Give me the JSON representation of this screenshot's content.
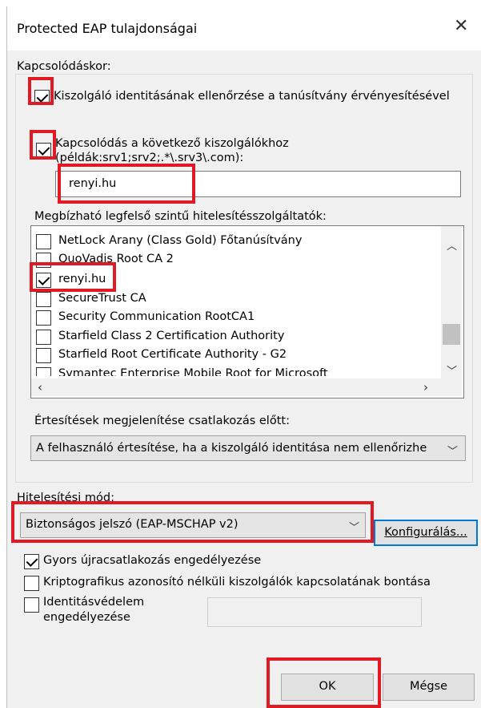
{
  "window": {
    "title": "Protected EAP tulajdonságai",
    "close_glyph": "✕"
  },
  "connect_section": {
    "label": "Kapcsolódáskor:",
    "verify_identity": {
      "label": "Kiszolgáló identitásának ellenőrzése a tanúsítvány érvényesítésével",
      "checked": true
    },
    "connect_servers": {
      "label_line1": "Kapcsolódás a következő kiszolgálókhoz",
      "label_line2": "(példák:srv1;srv2;.*\\.srv3\\.com):",
      "checked": true
    },
    "servers_value": "renyi.hu"
  },
  "trusted_roots": {
    "label": "Megbízható legfelső szintű hitelesítésszolgáltatók:",
    "items": [
      {
        "label": "NetLock Arany (Class Gold) Főtanúsítvány",
        "checked": false
      },
      {
        "label": "QuoVadis Root CA 2",
        "checked": false
      },
      {
        "label": "renyi.hu",
        "checked": true
      },
      {
        "label": "SecureTrust CA",
        "checked": false
      },
      {
        "label": "Security Communication RootCA1",
        "checked": false
      },
      {
        "label": "Starfield Class 2 Certification Authority",
        "checked": false
      },
      {
        "label": "Starfield Root Certificate Authority - G2",
        "checked": false
      },
      {
        "label": "Symantec Enterprise Mobile Root for Microsoft",
        "checked": false
      }
    ]
  },
  "notifications": {
    "label": "Értesítések megjelenítése csatlakozás előtt:",
    "selected": "A felhasználó értesítése, ha a kiszolgáló identitása nem ellenőrizhe"
  },
  "auth": {
    "label": "Hitelesítési mód:",
    "selected": "Biztonságos jelszó (EAP-MSCHAP v2)",
    "configure_label": "Konfigurálás..."
  },
  "options": {
    "fast_reconnect": {
      "label": "Gyors újracsatlakozás engedélyezése",
      "checked": true
    },
    "disconnect_no_crypto": {
      "label": "Kriptografikus azonosító nélküli kiszolgálók kapcsolatának bontása",
      "checked": false
    },
    "identity_privacy": {
      "label_line1": "Identitásvédelem",
      "label_line2": "engedélyezése",
      "checked": false
    }
  },
  "buttons": {
    "ok": "OK",
    "cancel": "Mégse"
  },
  "colors": {
    "highlight_red": "#e01a22",
    "focus_blue": "#0078d7"
  }
}
